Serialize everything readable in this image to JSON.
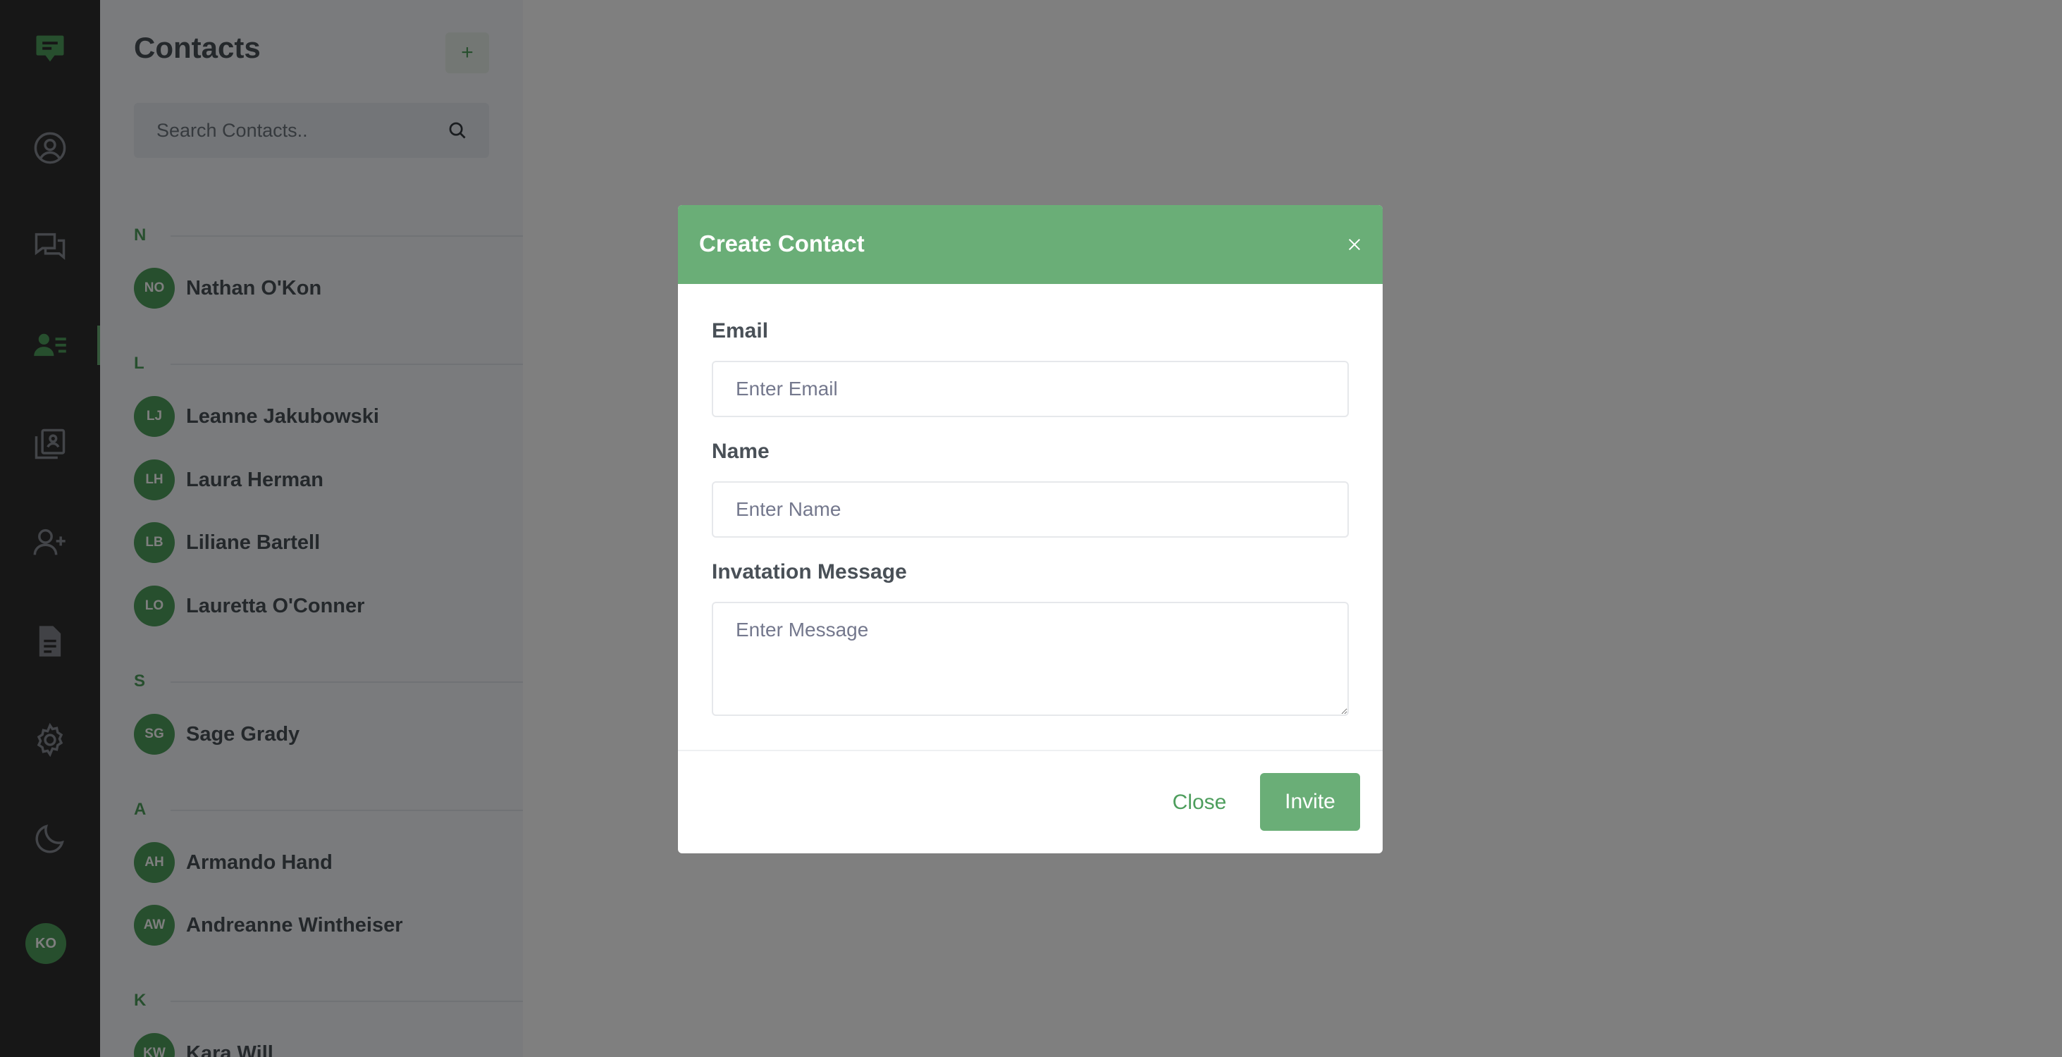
{
  "rail": {
    "items": [
      {
        "icon": "chat-logo-icon"
      },
      {
        "icon": "user-circle-icon"
      },
      {
        "icon": "chats-icon"
      },
      {
        "icon": "contacts-icon",
        "active": true
      },
      {
        "icon": "bookmark-book-icon"
      },
      {
        "icon": "user-add-icon"
      },
      {
        "icon": "document-icon"
      },
      {
        "icon": "gear-icon"
      },
      {
        "icon": "moon-icon"
      }
    ],
    "user_initials": "KO"
  },
  "contacts": {
    "title": "Contacts",
    "add_label": "+",
    "search_placeholder": "Search Contacts..",
    "groups": [
      {
        "letter": "N",
        "items": [
          {
            "initials": "NO",
            "name": "Nathan O'Kon"
          }
        ]
      },
      {
        "letter": "L",
        "items": [
          {
            "initials": "LJ",
            "name": "Leanne Jakubowski"
          },
          {
            "initials": "LH",
            "name": "Laura Herman"
          },
          {
            "initials": "LB",
            "name": "Liliane Bartell"
          },
          {
            "initials": "LO",
            "name": "Lauretta O'Conner"
          }
        ]
      },
      {
        "letter": "S",
        "items": [
          {
            "initials": "SG",
            "name": "Sage Grady"
          }
        ]
      },
      {
        "letter": "A",
        "items": [
          {
            "initials": "AH",
            "name": "Armando Hand"
          },
          {
            "initials": "AW",
            "name": "Andreanne Wintheiser"
          }
        ]
      },
      {
        "letter": "K",
        "items": [
          {
            "initials": "KW",
            "name": "Kara Will"
          }
        ]
      }
    ]
  },
  "modal": {
    "title": "Create Contact",
    "email_label": "Email",
    "email_placeholder": "Enter Email",
    "name_label": "Name",
    "name_placeholder": "Enter Name",
    "message_label": "Invatation Message",
    "message_placeholder": "Enter Message",
    "close_label": "Close",
    "invite_label": "Invite"
  },
  "colors": {
    "accent": "#6aae77",
    "accent_dark": "#4e9e5d",
    "rail_bg": "#2e2e2e",
    "panel_bg": "#f5f7fb"
  }
}
